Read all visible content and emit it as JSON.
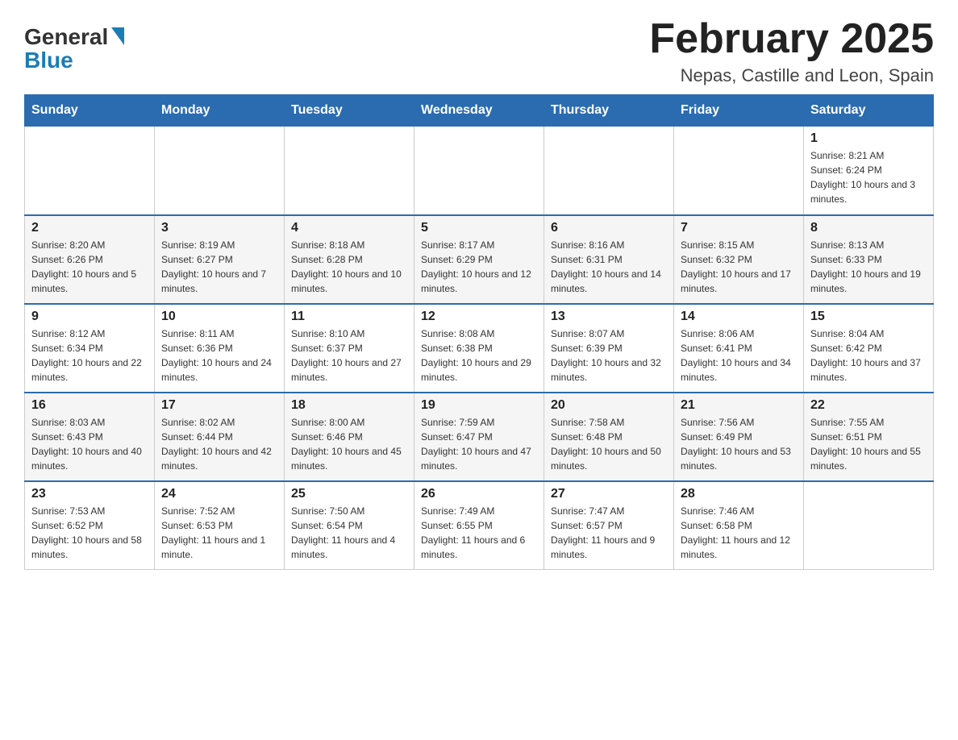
{
  "logo": {
    "general": "General",
    "blue": "Blue"
  },
  "title": "February 2025",
  "location": "Nepas, Castille and Leon, Spain",
  "days_of_week": [
    "Sunday",
    "Monday",
    "Tuesday",
    "Wednesday",
    "Thursday",
    "Friday",
    "Saturday"
  ],
  "weeks": [
    [
      {
        "day": "",
        "info": ""
      },
      {
        "day": "",
        "info": ""
      },
      {
        "day": "",
        "info": ""
      },
      {
        "day": "",
        "info": ""
      },
      {
        "day": "",
        "info": ""
      },
      {
        "day": "",
        "info": ""
      },
      {
        "day": "1",
        "info": "Sunrise: 8:21 AM\nSunset: 6:24 PM\nDaylight: 10 hours and 3 minutes."
      }
    ],
    [
      {
        "day": "2",
        "info": "Sunrise: 8:20 AM\nSunset: 6:26 PM\nDaylight: 10 hours and 5 minutes."
      },
      {
        "day": "3",
        "info": "Sunrise: 8:19 AM\nSunset: 6:27 PM\nDaylight: 10 hours and 7 minutes."
      },
      {
        "day": "4",
        "info": "Sunrise: 8:18 AM\nSunset: 6:28 PM\nDaylight: 10 hours and 10 minutes."
      },
      {
        "day": "5",
        "info": "Sunrise: 8:17 AM\nSunset: 6:29 PM\nDaylight: 10 hours and 12 minutes."
      },
      {
        "day": "6",
        "info": "Sunrise: 8:16 AM\nSunset: 6:31 PM\nDaylight: 10 hours and 14 minutes."
      },
      {
        "day": "7",
        "info": "Sunrise: 8:15 AM\nSunset: 6:32 PM\nDaylight: 10 hours and 17 minutes."
      },
      {
        "day": "8",
        "info": "Sunrise: 8:13 AM\nSunset: 6:33 PM\nDaylight: 10 hours and 19 minutes."
      }
    ],
    [
      {
        "day": "9",
        "info": "Sunrise: 8:12 AM\nSunset: 6:34 PM\nDaylight: 10 hours and 22 minutes."
      },
      {
        "day": "10",
        "info": "Sunrise: 8:11 AM\nSunset: 6:36 PM\nDaylight: 10 hours and 24 minutes."
      },
      {
        "day": "11",
        "info": "Sunrise: 8:10 AM\nSunset: 6:37 PM\nDaylight: 10 hours and 27 minutes."
      },
      {
        "day": "12",
        "info": "Sunrise: 8:08 AM\nSunset: 6:38 PM\nDaylight: 10 hours and 29 minutes."
      },
      {
        "day": "13",
        "info": "Sunrise: 8:07 AM\nSunset: 6:39 PM\nDaylight: 10 hours and 32 minutes."
      },
      {
        "day": "14",
        "info": "Sunrise: 8:06 AM\nSunset: 6:41 PM\nDaylight: 10 hours and 34 minutes."
      },
      {
        "day": "15",
        "info": "Sunrise: 8:04 AM\nSunset: 6:42 PM\nDaylight: 10 hours and 37 minutes."
      }
    ],
    [
      {
        "day": "16",
        "info": "Sunrise: 8:03 AM\nSunset: 6:43 PM\nDaylight: 10 hours and 40 minutes."
      },
      {
        "day": "17",
        "info": "Sunrise: 8:02 AM\nSunset: 6:44 PM\nDaylight: 10 hours and 42 minutes."
      },
      {
        "day": "18",
        "info": "Sunrise: 8:00 AM\nSunset: 6:46 PM\nDaylight: 10 hours and 45 minutes."
      },
      {
        "day": "19",
        "info": "Sunrise: 7:59 AM\nSunset: 6:47 PM\nDaylight: 10 hours and 47 minutes."
      },
      {
        "day": "20",
        "info": "Sunrise: 7:58 AM\nSunset: 6:48 PM\nDaylight: 10 hours and 50 minutes."
      },
      {
        "day": "21",
        "info": "Sunrise: 7:56 AM\nSunset: 6:49 PM\nDaylight: 10 hours and 53 minutes."
      },
      {
        "day": "22",
        "info": "Sunrise: 7:55 AM\nSunset: 6:51 PM\nDaylight: 10 hours and 55 minutes."
      }
    ],
    [
      {
        "day": "23",
        "info": "Sunrise: 7:53 AM\nSunset: 6:52 PM\nDaylight: 10 hours and 58 minutes."
      },
      {
        "day": "24",
        "info": "Sunrise: 7:52 AM\nSunset: 6:53 PM\nDaylight: 11 hours and 1 minute."
      },
      {
        "day": "25",
        "info": "Sunrise: 7:50 AM\nSunset: 6:54 PM\nDaylight: 11 hours and 4 minutes."
      },
      {
        "day": "26",
        "info": "Sunrise: 7:49 AM\nSunset: 6:55 PM\nDaylight: 11 hours and 6 minutes."
      },
      {
        "day": "27",
        "info": "Sunrise: 7:47 AM\nSunset: 6:57 PM\nDaylight: 11 hours and 9 minutes."
      },
      {
        "day": "28",
        "info": "Sunrise: 7:46 AM\nSunset: 6:58 PM\nDaylight: 11 hours and 12 minutes."
      },
      {
        "day": "",
        "info": ""
      }
    ]
  ]
}
